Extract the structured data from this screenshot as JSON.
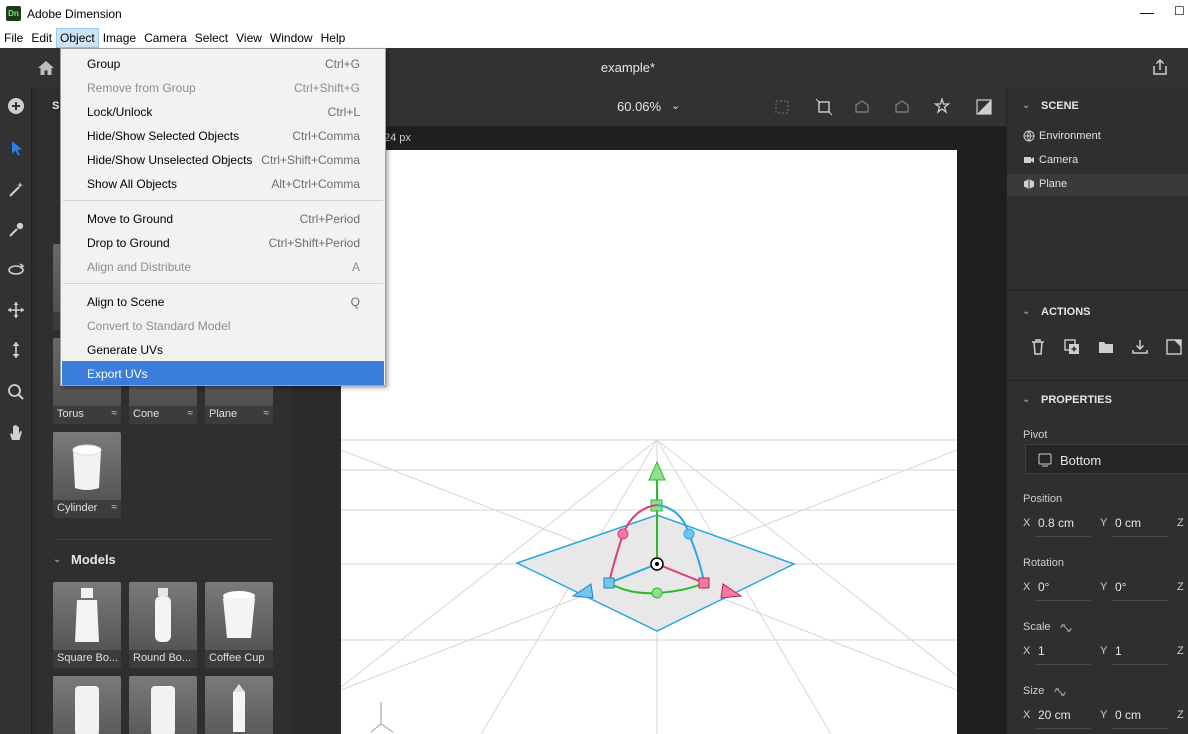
{
  "window": {
    "app_title": "Adobe Dimension",
    "logo_text": "Dn",
    "minimize_glyph": "—",
    "maximize_glyph": "☐"
  },
  "menubar": {
    "items": [
      "File",
      "Edit",
      "Object",
      "Image",
      "Camera",
      "Select",
      "View",
      "Window",
      "Help"
    ],
    "active": "Object"
  },
  "header": {
    "document_title": "example*"
  },
  "object_menu": {
    "items": [
      {
        "label": "Group",
        "shortcut": "Ctrl+G",
        "enabled": true
      },
      {
        "label": "Remove from Group",
        "shortcut": "Ctrl+Shift+G",
        "enabled": false
      },
      {
        "label": "Lock/Unlock",
        "shortcut": "Ctrl+L",
        "enabled": true
      },
      {
        "label": "Hide/Show Selected Objects",
        "shortcut": "Ctrl+Comma",
        "enabled": true
      },
      {
        "label": "Hide/Show Unselected Objects",
        "shortcut": "Ctrl+Shift+Comma",
        "enabled": true
      },
      {
        "label": "Show All Objects",
        "shortcut": "Alt+Ctrl+Comma",
        "enabled": true
      },
      {
        "label": "Move to Ground",
        "shortcut": "Ctrl+Period",
        "enabled": true
      },
      {
        "label": "Drop to Ground",
        "shortcut": "Ctrl+Shift+Period",
        "enabled": true
      },
      {
        "label": "Align and Distribute",
        "shortcut": "A",
        "enabled": false
      },
      {
        "label": "Align to Scene",
        "shortcut": "Q",
        "enabled": true
      },
      {
        "label": "Convert to Standard Model",
        "shortcut": "",
        "enabled": false
      },
      {
        "label": "Generate UVs",
        "shortcut": "",
        "enabled": true
      },
      {
        "label": "Export UVs",
        "shortcut": "",
        "enabled": true,
        "highlighted": true
      }
    ]
  },
  "assets": {
    "header_fragment": "S",
    "basic_shapes": [
      {
        "label": "Torus"
      },
      {
        "label": "Cone"
      },
      {
        "label": "Plane"
      },
      {
        "label": "Cylinder"
      }
    ],
    "models_title": "Models",
    "models": [
      {
        "label": "Square Bo..."
      },
      {
        "label": "Round Bo..."
      },
      {
        "label": "Coffee Cup"
      }
    ]
  },
  "viewport": {
    "zoom": "60.06%",
    "canvas_size_fragment": "24 px"
  },
  "scene": {
    "title": "SCENE",
    "items": [
      {
        "label": "Environment",
        "icon": "globe-icon"
      },
      {
        "label": "Camera",
        "icon": "camera-icon"
      },
      {
        "label": "Plane",
        "icon": "cube-icon",
        "selected": true
      }
    ]
  },
  "actions": {
    "title": "ACTIONS"
  },
  "properties": {
    "title": "PROPERTIES",
    "pivot_label": "Pivot",
    "pivot_value": "Bottom",
    "position_label": "Position",
    "position": {
      "x": "0.8 cm",
      "y": "0 cm"
    },
    "rotation_label": "Rotation",
    "rotation": {
      "x": "0°",
      "y": "0°"
    },
    "scale_label": "Scale",
    "scale": {
      "x": "1",
      "y": "1"
    },
    "size_label": "Size",
    "size": {
      "x": "20 cm",
      "y": "0 cm"
    },
    "axis_x": "X",
    "axis_y": "Y",
    "axis_z": "Z"
  },
  "colors": {
    "accent": "#2680eb",
    "menu_highlight": "#3b7ddd",
    "gizmo_green": "#2dbb2d",
    "gizmo_pink": "#e0397a",
    "gizmo_blue": "#2aa7e0"
  }
}
